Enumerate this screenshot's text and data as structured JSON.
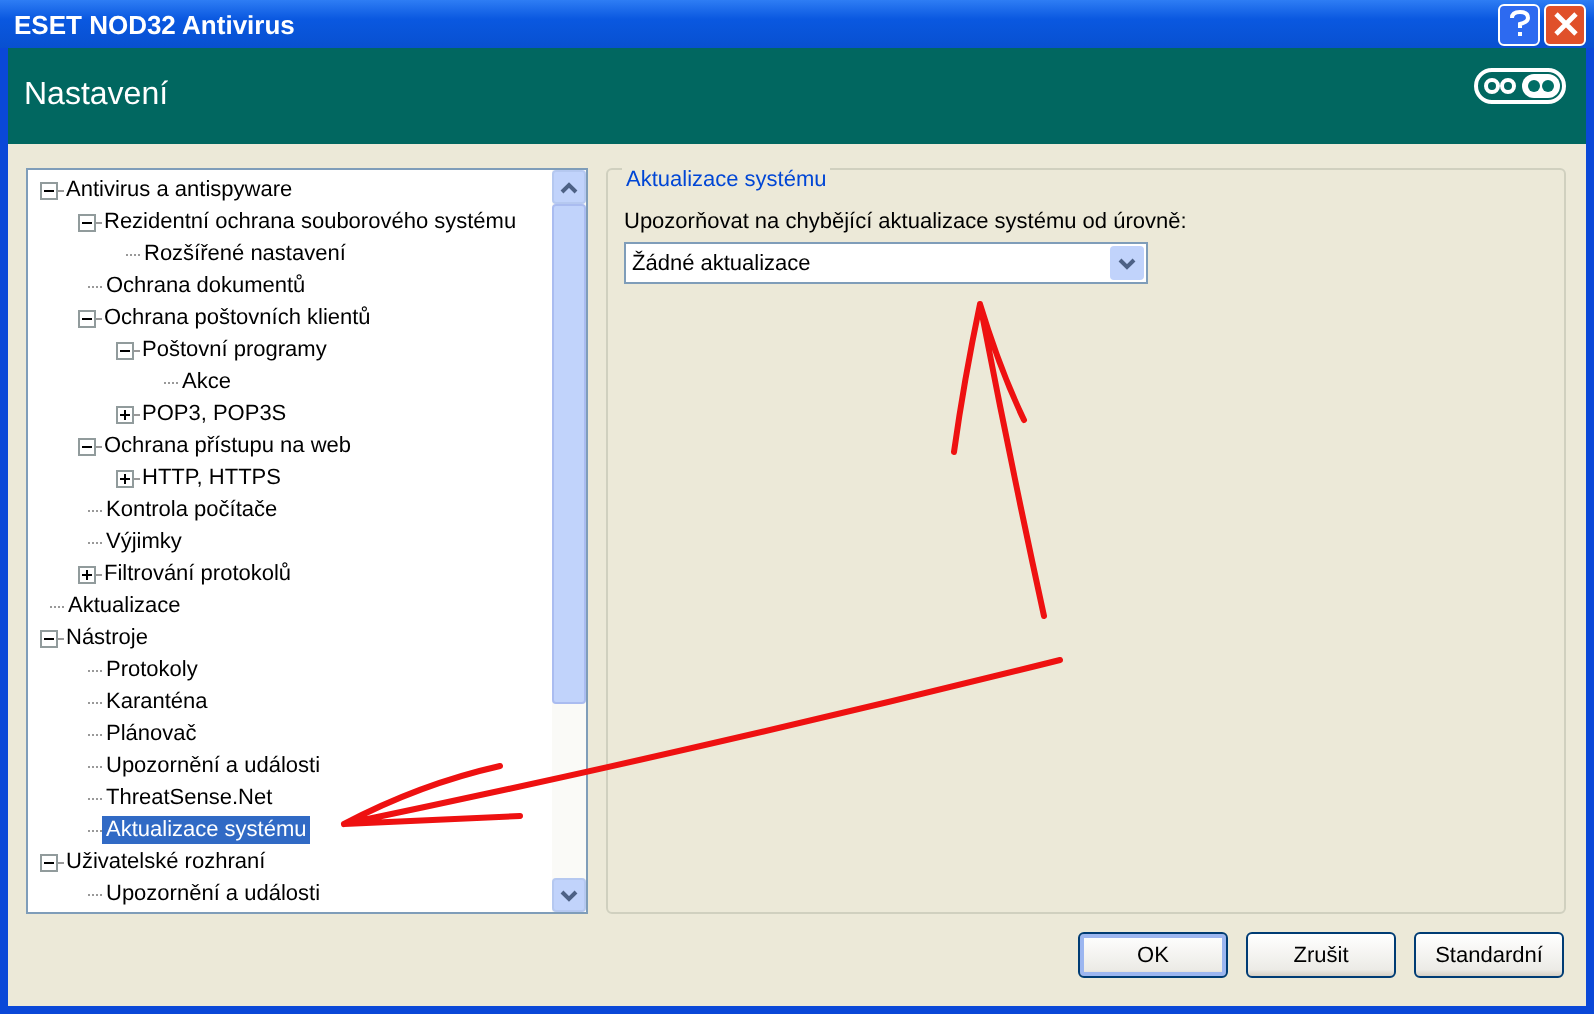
{
  "window": {
    "title": "ESET NOD32 Antivirus"
  },
  "header": {
    "title": "Nastavení"
  },
  "tree": [
    {
      "label": "Antivirus a antispyware",
      "expanded": true,
      "selected": false,
      "children": [
        {
          "label": "Rezidentní ochrana souborového systému",
          "expanded": true,
          "selected": false,
          "children": [
            {
              "label": "Rozšířené nastavení",
              "selected": false
            }
          ]
        },
        {
          "label": "Ochrana dokumentů",
          "selected": false
        },
        {
          "label": "Ochrana poštovních klientů",
          "expanded": true,
          "selected": false,
          "children": [
            {
              "label": "Poštovní programy",
              "expanded": true,
              "selected": false,
              "children": [
                {
                  "label": "Akce",
                  "selected": false
                }
              ]
            },
            {
              "label": "POP3, POP3S",
              "expanded": false,
              "selected": false
            }
          ]
        },
        {
          "label": "Ochrana přístupu na web",
          "expanded": true,
          "selected": false,
          "children": [
            {
              "label": "HTTP, HTTPS",
              "expanded": false,
              "selected": false
            }
          ]
        },
        {
          "label": "Kontrola počítače",
          "selected": false
        },
        {
          "label": "Výjimky",
          "selected": false
        },
        {
          "label": "Filtrování protokolů",
          "expanded": false,
          "selected": false
        }
      ]
    },
    {
      "label": "Aktualizace",
      "selected": false
    },
    {
      "label": "Nástroje",
      "expanded": true,
      "selected": false,
      "children": [
        {
          "label": "Protokoly",
          "selected": false
        },
        {
          "label": "Karanténa",
          "selected": false
        },
        {
          "label": "Plánovač",
          "selected": false
        },
        {
          "label": "Upozornění a události",
          "selected": false
        },
        {
          "label": "ThreatSense.Net",
          "selected": false
        },
        {
          "label": "Aktualizace systému",
          "selected": true
        }
      ]
    },
    {
      "label": "Uživatelské rozhraní",
      "expanded": true,
      "selected": false,
      "children": [
        {
          "label": "Upozornění a události",
          "selected": false
        }
      ]
    }
  ],
  "panel": {
    "title": "Aktualizace systému",
    "field_label": "Upozorňovat na chybějící aktualizace systému od úrovně:",
    "dropdown_value": "Žádné aktualizace"
  },
  "buttons": [
    {
      "label": "OK",
      "default": true
    },
    {
      "label": "Zrušit",
      "default": false
    },
    {
      "label": "Standardní",
      "default": false
    }
  ],
  "annotations": [
    {
      "kind": "arrow"
    },
    {
      "kind": "arrow"
    }
  ]
}
